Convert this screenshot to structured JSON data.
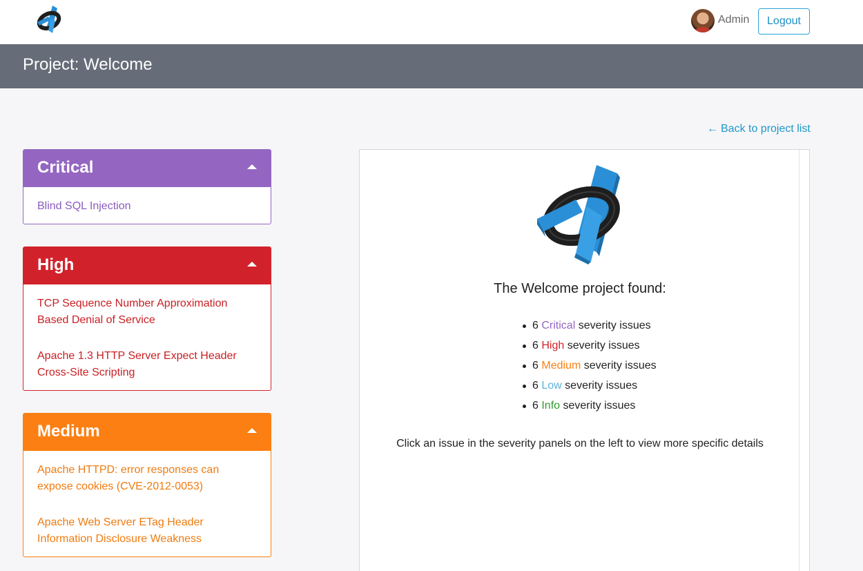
{
  "header": {
    "logo_icon": "app-logo-icon",
    "user_name": "Admin",
    "logout_label": "Logout",
    "avatar_icon": "user-avatar"
  },
  "page": {
    "title": "Project: Welcome",
    "back_link": "Back to project list",
    "back_icon": "arrow-left-icon"
  },
  "colors": {
    "critical": "#9466c2",
    "high": "#d1222b",
    "medium": "#fb7f12",
    "low": "#5bb4d8",
    "info": "#2e9c2e",
    "header_band": "#666d79",
    "link": "#1f97c9"
  },
  "panels": [
    {
      "title": "Critical",
      "issues": [
        "Blind SQL Injection"
      ]
    },
    {
      "title": "High",
      "issues": [
        "TCP Sequence Number Approximation Based Denial of Service",
        "Apache 1.3 HTTP Server Expect Header Cross-Site Scripting"
      ]
    },
    {
      "title": "Medium",
      "issues": [
        "Apache HTTPD: error responses can expose cookies (CVE-2012-0053)",
        "Apache Web Server ETag Header Information Disclosure Weakness"
      ]
    }
  ],
  "summary": {
    "title": "The Welcome project found:",
    "items": [
      {
        "count": "6",
        "level": "Critical",
        "suffix": "severity issues"
      },
      {
        "count": "6",
        "level": "High",
        "suffix": "severity issues"
      },
      {
        "count": "6",
        "level": "Medium",
        "suffix": "severity issues"
      },
      {
        "count": "6",
        "level": "Low",
        "suffix": "severity issues"
      },
      {
        "count": "6",
        "level": "Info",
        "suffix": "severity issues"
      }
    ],
    "hint": "Click an issue in the severity panels on the left to view more specific details"
  }
}
